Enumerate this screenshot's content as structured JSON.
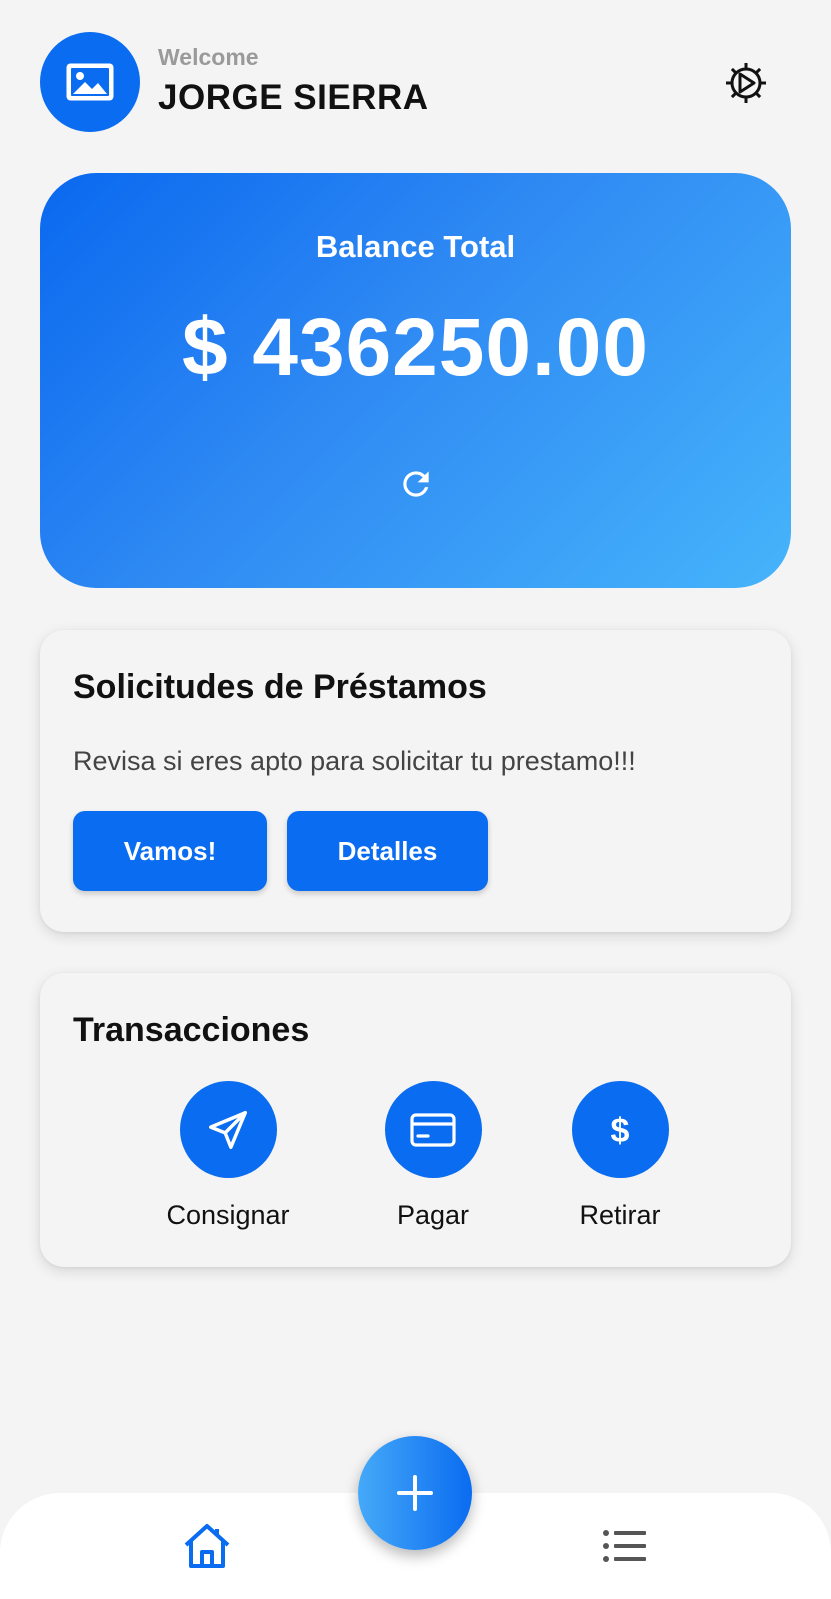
{
  "header": {
    "welcome": "Welcome",
    "user_name": "JORGE SIERRA",
    "avatar_icon": "image-icon",
    "settings_icon": "gear-icon"
  },
  "balance": {
    "title": "Balance Total",
    "amount": "$ 436250.00",
    "refresh_icon": "refresh-icon"
  },
  "loans": {
    "title": "Solicitudes de Préstamos",
    "description": "Revisa si eres apto para solicitar tu prestamo!!!",
    "primary_button": "Vamos!",
    "secondary_button": "Detalles"
  },
  "transactions": {
    "title": "Transacciones",
    "items": [
      {
        "label": "Consignar",
        "icon": "send-icon"
      },
      {
        "label": "Pagar",
        "icon": "credit-card-icon"
      },
      {
        "label": "Retirar",
        "icon": "dollar-icon"
      }
    ]
  },
  "bottom_nav": {
    "home_icon": "home-icon",
    "add_icon": "plus-icon",
    "list_icon": "list-icon"
  },
  "colors": {
    "primary": "#0a6cf0",
    "gradient_light": "#46b4fb",
    "background": "#f4f4f4"
  }
}
